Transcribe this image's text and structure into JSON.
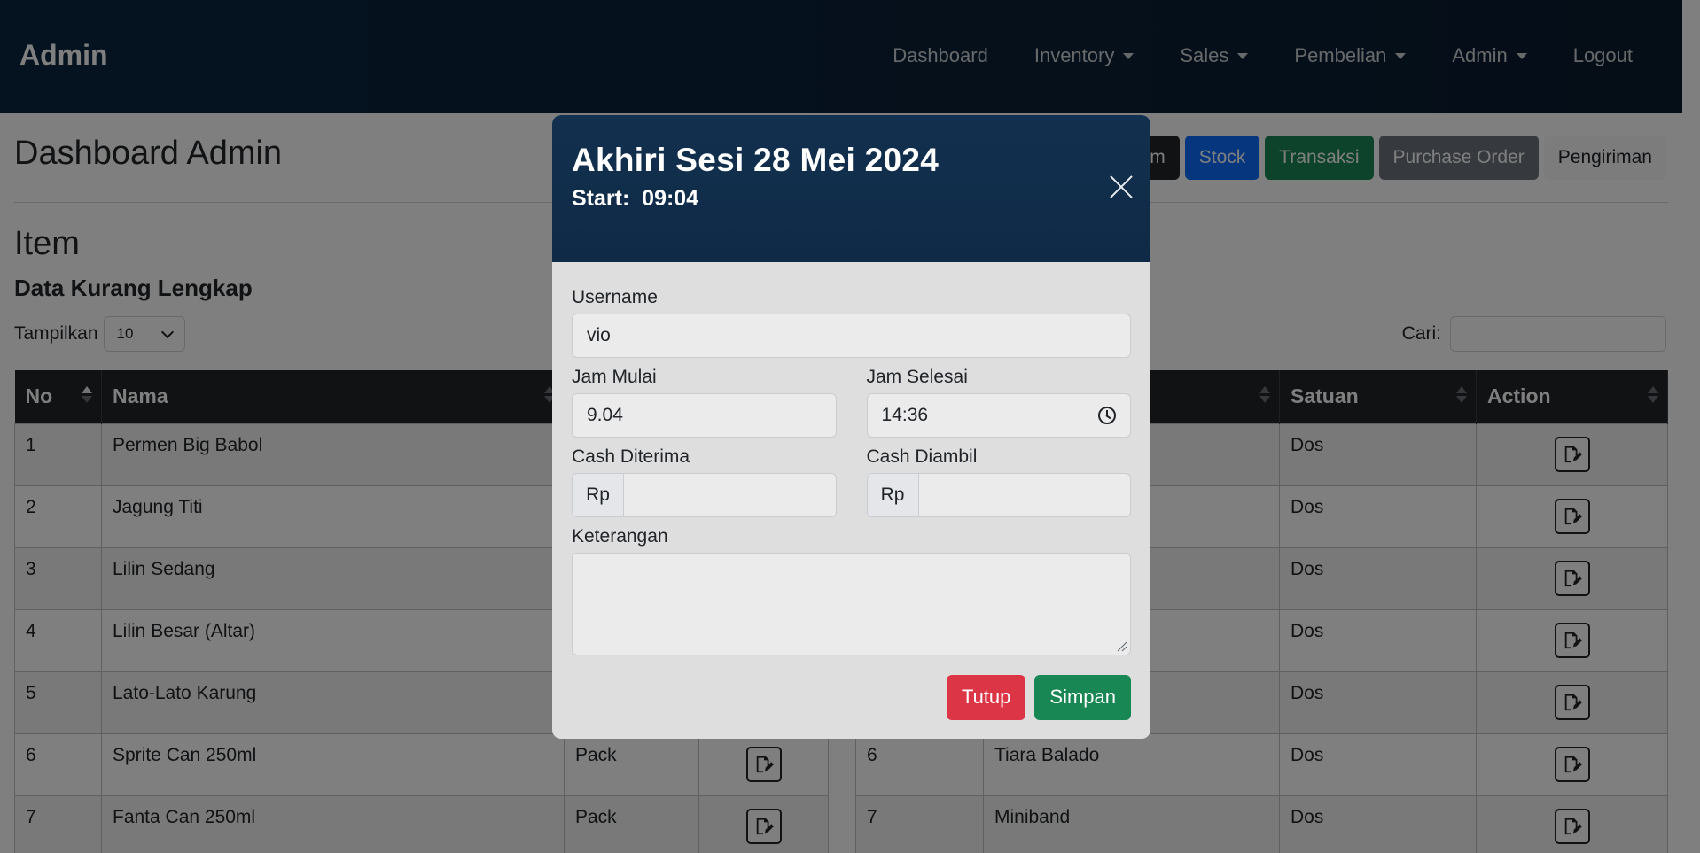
{
  "navbar": {
    "brand": "Admin",
    "items": [
      {
        "label": "Dashboard",
        "dropdown": false
      },
      {
        "label": "Inventory",
        "dropdown": true
      },
      {
        "label": "Sales",
        "dropdown": true
      },
      {
        "label": "Pembelian",
        "dropdown": true
      },
      {
        "label": "Admin",
        "dropdown": true
      },
      {
        "label": "Logout",
        "dropdown": false
      }
    ]
  },
  "page": {
    "title": "Dashboard Admin",
    "section_title": "Item",
    "section_subtitle": "Data Kurang Lengkap",
    "show_label": "Tampilkan",
    "show_value": "10",
    "search_label": "Cari:",
    "top_buttons": {
      "partial": "m",
      "stock": "Stock",
      "transaksi": "Transaksi",
      "purchase_order": "Purchase Order",
      "pengiriman": "Pengiriman"
    }
  },
  "left_table": {
    "headers": {
      "no": "No",
      "nama": "Nama"
    },
    "rows": [
      {
        "no": "1",
        "nama": "Permen Big Babol",
        "satuan": ""
      },
      {
        "no": "2",
        "nama": "Jagung Titi",
        "satuan": ""
      },
      {
        "no": "3",
        "nama": "Lilin Sedang",
        "satuan": ""
      },
      {
        "no": "4",
        "nama": "Lilin Besar (Altar)",
        "satuan": ""
      },
      {
        "no": "5",
        "nama": "Lato-Lato Karung",
        "satuan": ""
      },
      {
        "no": "6",
        "nama": "Sprite Can 250ml",
        "satuan": "Pack"
      },
      {
        "no": "7",
        "nama": "Fanta Can 250ml",
        "satuan": "Pack"
      }
    ]
  },
  "right_table": {
    "headers": {
      "satuan": "Satuan",
      "action": "Action"
    },
    "rows": [
      {
        "no": "",
        "nama": "",
        "satuan": "Dos"
      },
      {
        "no": "",
        "nama": "",
        "satuan": "Dos"
      },
      {
        "no": "",
        "nama": "",
        "satuan": "Dos"
      },
      {
        "no": "",
        "nama": "",
        "satuan": "Dos"
      },
      {
        "no": "",
        "nama": "",
        "satuan": "Dos"
      },
      {
        "no": "6",
        "nama": "Tiara Balado",
        "satuan": "Dos"
      },
      {
        "no": "7",
        "nama": "Miniband",
        "satuan": "Dos"
      }
    ]
  },
  "modal": {
    "title": "Akhiri Sesi 28 Mei 2024",
    "start": "Start:  09:04",
    "username_label": "Username",
    "username_value": "vio",
    "jam_mulai_label": "Jam Mulai",
    "jam_mulai_value": "9.04",
    "jam_selesai_label": "Jam Selesai",
    "jam_selesai_value": "14:36",
    "cash_diterima_label": "Cash Diterima",
    "cash_diambil_label": "Cash Diambil",
    "currency": "Rp",
    "keterangan_label": "Keterangan",
    "btn_tutup": "Tutup",
    "btn_simpan": "Simpan"
  }
}
